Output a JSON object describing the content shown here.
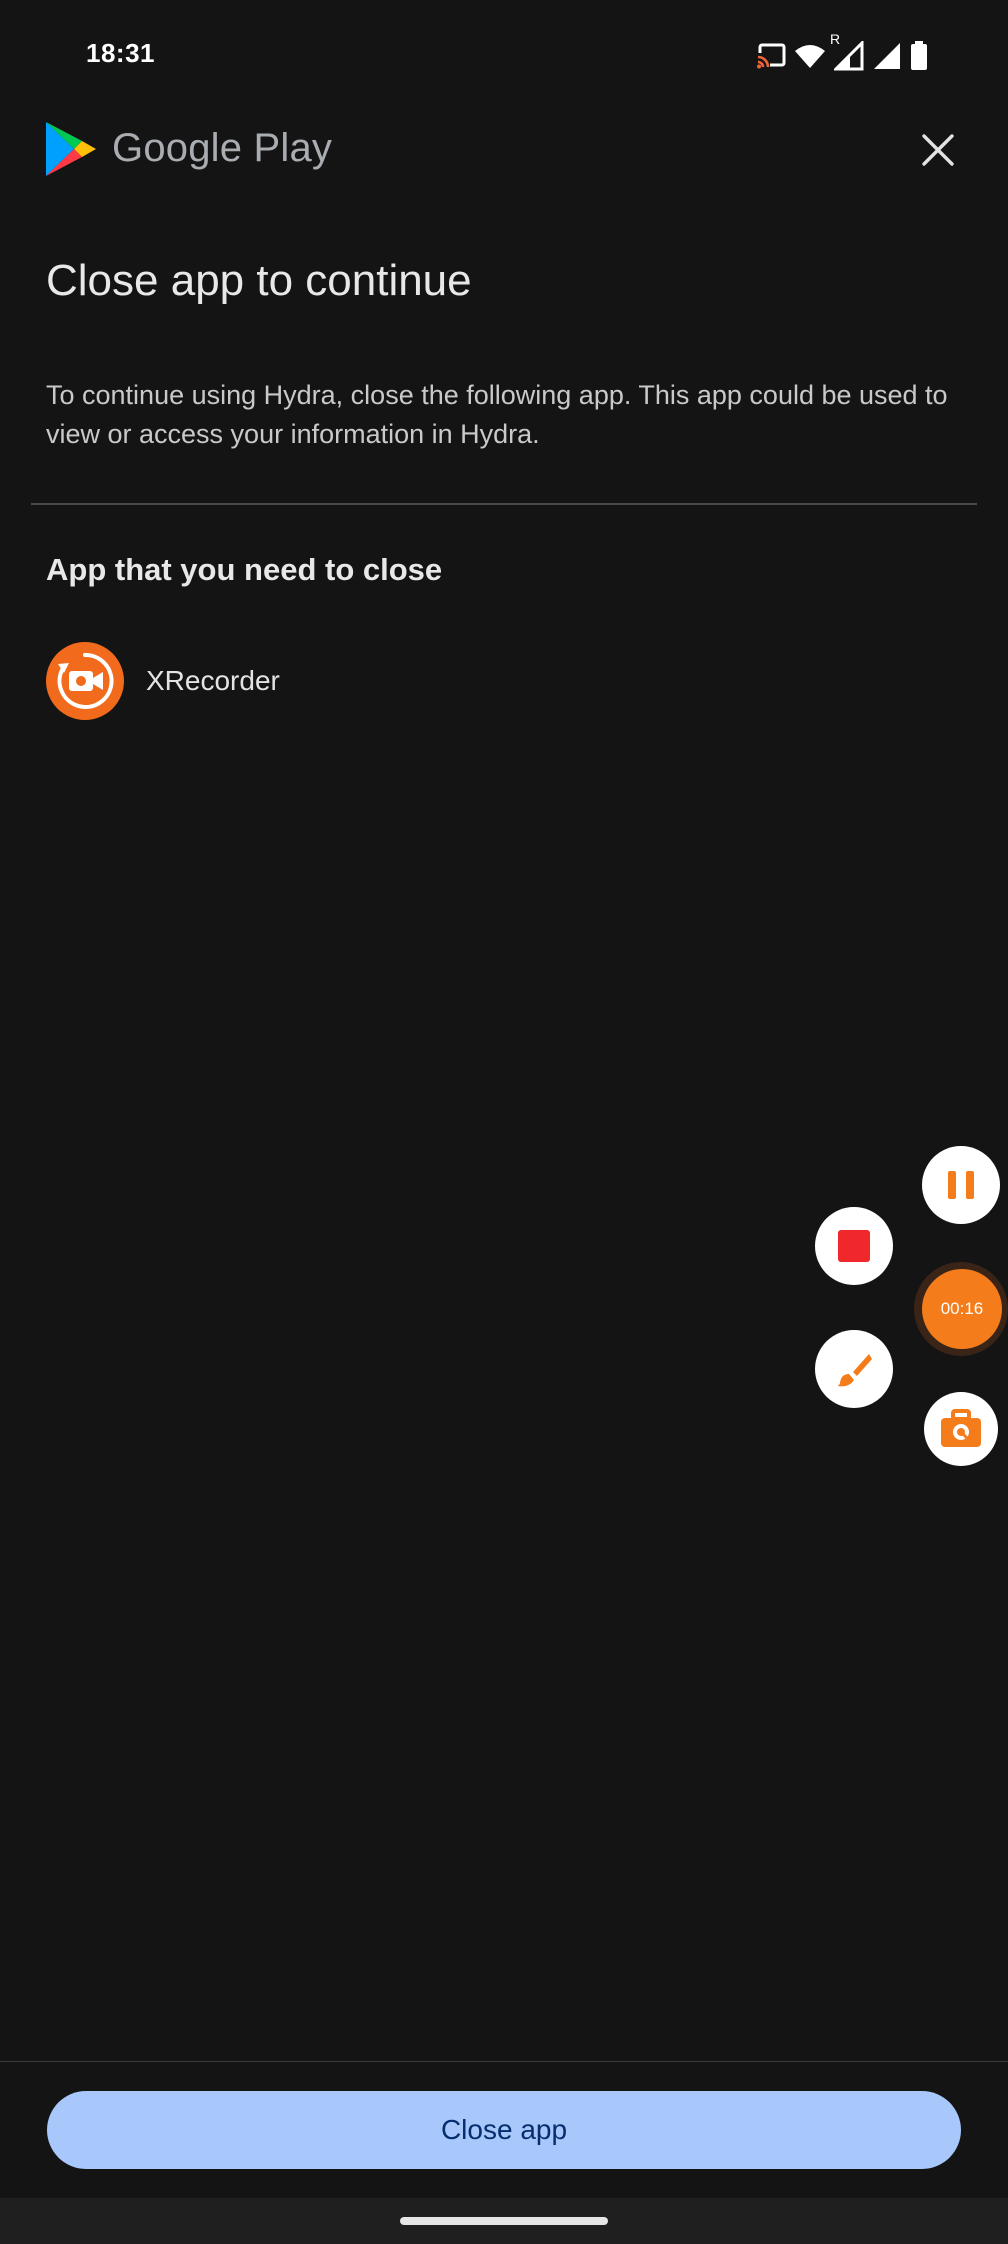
{
  "status_bar": {
    "time": "18:31",
    "icons": [
      "cast-icon",
      "wifi-icon",
      "signal-roaming-icon",
      "signal-icon",
      "battery-icon"
    ],
    "roaming_label": "R"
  },
  "header": {
    "brand": "Google Play",
    "logo_icon": "google-play-logo",
    "close_icon": "close-icon"
  },
  "dialog": {
    "title": "Close app to continue",
    "description": "To continue using Hydra, close the following app. This app could be used to view or access your information in Hydra.",
    "section_heading": "App that you need to close",
    "apps": [
      {
        "name": "XRecorder",
        "icon": "xrecorder-icon",
        "icon_color": "#f26a1b"
      }
    ]
  },
  "recorder_overlay": {
    "timer": "00:16",
    "pause_icon": "pause-icon",
    "stop_icon": "stop-icon",
    "brush_icon": "brush-icon",
    "toolbox_icon": "toolbox-icon",
    "accent_color": "#f57c1a"
  },
  "footer": {
    "close_button_label": "Close app",
    "button_color": "#a8c7fa"
  }
}
